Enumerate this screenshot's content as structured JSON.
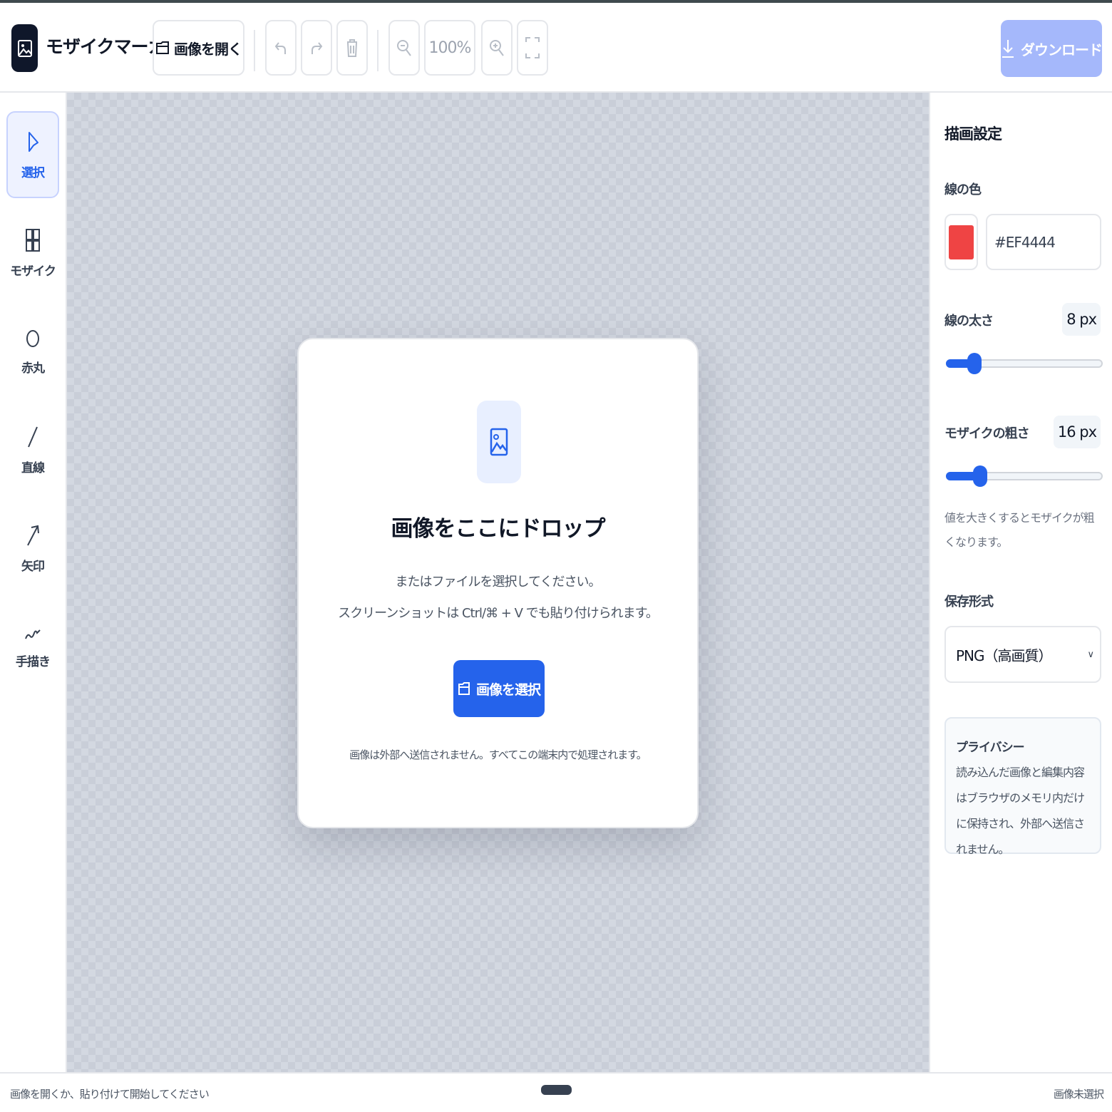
{
  "header": {
    "app_title": "モザイクマーカー",
    "open_label": "画像を開く",
    "zoom_value": "100%",
    "download_label": "ダウンロード"
  },
  "toolbar": {
    "tools": [
      {
        "label": "選択",
        "icon": "cursor-icon",
        "active": true
      },
      {
        "label": "モザイク",
        "icon": "grid-icon",
        "active": false
      },
      {
        "label": "赤丸",
        "icon": "circle-icon",
        "active": false
      },
      {
        "label": "直線",
        "icon": "line-icon",
        "active": false
      },
      {
        "label": "矢印",
        "icon": "arrow-icon",
        "active": false
      },
      {
        "label": "手描き",
        "icon": "freehand-icon",
        "active": false
      }
    ]
  },
  "dropzone": {
    "title": "画像をここにドロップ",
    "subtitle_line1": "またはファイルを選択してください。",
    "subtitle_line2": "スクリーンショットは Ctrl/⌘ + V でも貼り付けられます。",
    "select_label": "画像を選択",
    "privacy_note": "画像は外部へ送信されません。すべてこの端末内で処理されます。"
  },
  "panel": {
    "title": "描画設定",
    "line_color_label": "線の色",
    "line_color_value": "#EF4444",
    "line_width_label": "線の太さ",
    "line_width_value": "8 px",
    "line_width_fraction": 0.18,
    "mosaic_label": "モザイクの粗さ",
    "mosaic_value": "16 px",
    "mosaic_fraction": 0.22,
    "mosaic_hint": "値を大きくするとモザイクが粗くなります。",
    "format_label": "保存形式",
    "format_value": "PNG（高画質）",
    "privacy_title": "プライバシー",
    "privacy_body": "読み込んだ画像と編集内容はブラウザのメモリ内だけに保持され、外部へ送信されません。"
  },
  "status": {
    "left": "画像を開くか、貼り付けて開始してください",
    "right": "画像未選択"
  },
  "colors": {
    "accent": "#2563eb",
    "download_disabled": "#a5b8fb",
    "stroke_color": "#EF4444",
    "logo_bg": "#0f172a"
  }
}
